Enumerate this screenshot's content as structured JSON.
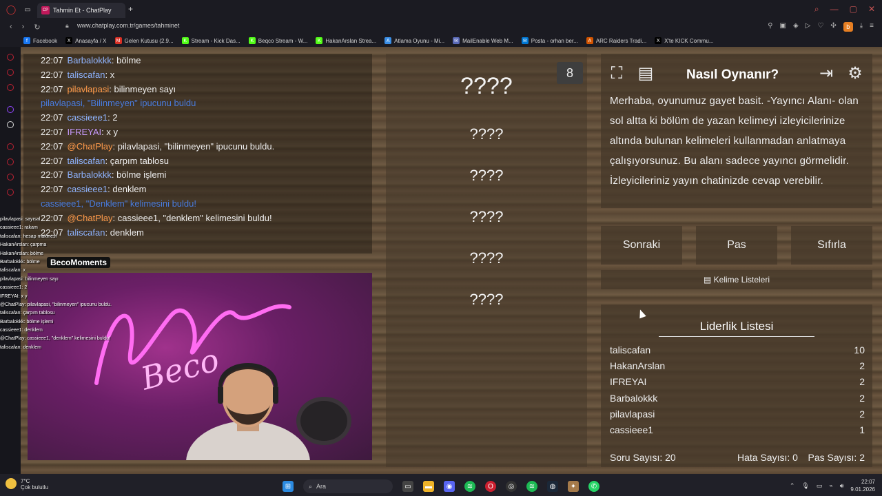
{
  "browser": {
    "tab_title": "Tahmin Et - ChatPlay",
    "tab_favicon": "CP",
    "url": "www.chatplay.com.tr/games/tahminet"
  },
  "bookmarks": [
    {
      "label": "Facebook",
      "color": "#1877f2",
      "icon": "f"
    },
    {
      "label": "Anasayfa / X",
      "color": "#000000",
      "icon": "X"
    },
    {
      "label": "Gelen Kutusu (2.9...",
      "color": "#d93025",
      "icon": "M"
    },
    {
      "label": "Stream - Kick Das...",
      "color": "#53fc18",
      "icon": "K"
    },
    {
      "label": "Beqco Stream - W...",
      "color": "#53fc18",
      "icon": "K"
    },
    {
      "label": "HakanArslan Strea...",
      "color": "#53fc18",
      "icon": "K"
    },
    {
      "label": "Atlama Oyunu - Mi...",
      "color": "#3a8ee6",
      "icon": "A"
    },
    {
      "label": "MailEnable Web M...",
      "color": "#5a6ab8",
      "icon": "✉"
    },
    {
      "label": "Posta - orhan ber...",
      "color": "#0078d4",
      "icon": "✉"
    },
    {
      "label": "ARC Raiders Tradi...",
      "color": "#d35400",
      "icon": "A"
    },
    {
      "label": "X'te KICK Commu...",
      "color": "#000000",
      "icon": "X"
    }
  ],
  "chat": [
    {
      "time": "22:07",
      "user": "Barbalokkk",
      "user_color": "#8fb4ff",
      "text": "bölme"
    },
    {
      "time": "22:07",
      "user": "taliscafan",
      "user_color": "#8fb4ff",
      "text": "x"
    },
    {
      "time": "22:07",
      "user": "pilavlapasi",
      "user_color": "#ff9a4a",
      "text": "bilinmeyen sayı"
    },
    {
      "time": "",
      "system": "pilavlapasi, \"Bilinmeyen\" ipucunu buldu",
      "user_color": "#4a7de0"
    },
    {
      "time": "22:07",
      "user": "cassieee1",
      "user_color": "#8fb4ff",
      "text": "2"
    },
    {
      "time": "22:07",
      "user": "IFREYAI",
      "user_color": "#c99cff",
      "text": "x y"
    },
    {
      "time": "22:07",
      "user": "@ChatPlay",
      "user_color": "#ff9a4a",
      "text": "pilavlapasi, \"bilinmeyen\" ipucunu buldu."
    },
    {
      "time": "22:07",
      "user": "taliscafan",
      "user_color": "#8fb4ff",
      "text": "çarpım tablosu"
    },
    {
      "time": "22:07",
      "user": "Barbalokkk",
      "user_color": "#8fb4ff",
      "text": "bölme işlemi"
    },
    {
      "time": "22:07",
      "user": "cassieee1",
      "user_color": "#8fb4ff",
      "text": "denklem"
    },
    {
      "time": "",
      "system": "cassieee1, \"Denklem\" kelimesini buldu!",
      "user_color": "#4a7de0"
    },
    {
      "time": "22:07",
      "user": "@ChatPlay",
      "user_color": "#ff9a4a",
      "text": "cassieee1, \"denklem\" kelimesini buldu!"
    },
    {
      "time": "22:07",
      "user": "taliscafan",
      "user_color": "#8fb4ff",
      "text": "denklem"
    }
  ],
  "overlay_chat": [
    "pilavlapasi: sayısal",
    "cassieee1: rakam",
    "taliscafan: hesap makinesi",
    "HakanArslan: çarpma",
    "HakanArslan: bölme",
    "Barbalokkk: bölme",
    "taliscafan: x",
    "pilavlapasi: bilinmeyen sayı",
    "cassieee1: 2",
    "IFREYAI: x y",
    "@ChatPlay: pilavlapasi, \"bilinmeyen\" ipucunu buldu.",
    "taliscafan: çarpım tablosu",
    "Barbalokkk: bölme işlemi",
    "cassieee1: denklem",
    "@ChatPlay: cassieee1, \"denklem\" kelimesini buldu!",
    "taliscafan: denklem"
  ],
  "moments_badge": "BecoMoments",
  "game": {
    "target": "????",
    "hints": [
      "????",
      "????",
      "????",
      "????",
      "????"
    ],
    "counter": "8"
  },
  "howto": {
    "title": "Nasıl Oynanır?",
    "text": "Merhaba, oyunumuz gayet basit. -Yayıncı Alanı- olan sol altta ki bölüm de yazan kelimeyi izleyicilerinize altında bulunan kelimeleri kullanmadan anlatmaya çalışıyorsunuz. Bu alanı sadece yayıncı görmelidir. İzleyicileriniz yayın chatinizde cevap verebilir."
  },
  "buttons": {
    "next": "Sonraki",
    "pass": "Pas",
    "reset": "Sıfırla",
    "word_lists": "Kelime Listeleri"
  },
  "leaderboard": {
    "title": "Liderlik Listesi",
    "rows": [
      {
        "name": "taliscafan",
        "score": "10"
      },
      {
        "name": "HakanArslan",
        "score": "2"
      },
      {
        "name": "IFREYAI",
        "score": "2"
      },
      {
        "name": "Barbalokkk",
        "score": "2"
      },
      {
        "name": "pilavlapasi",
        "score": "2"
      },
      {
        "name": "cassieee1",
        "score": "1"
      }
    ],
    "question_count": "Soru Sayısı: 20",
    "error_count": "Hata Sayısı: 0",
    "pass_count": "Pas Sayısı: 2"
  },
  "taskbar": {
    "temp": "7°C",
    "weather": "Çok bulutlu",
    "search": "Ara",
    "time": "22:07",
    "date": "9.01.2026"
  }
}
